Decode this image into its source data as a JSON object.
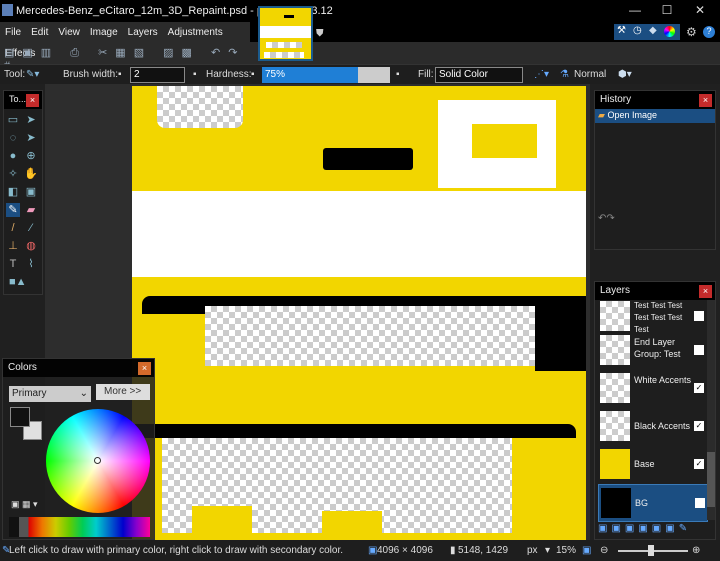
{
  "window": {
    "title": "Mercedes-Benz_eCitaro_12m_3D_Repaint.psd - paint.net 4.3.12",
    "minimize": "—",
    "maximize": "☐",
    "close": "✕"
  },
  "menu": [
    "File",
    "Edit",
    "View",
    "Image",
    "Layers",
    "Adjustments",
    "Effects"
  ],
  "options": {
    "tool_label": "Tool:",
    "brush_width_label": "Brush width:",
    "brush_width": "2",
    "hardness_label": "Hardness:",
    "hardness": "75%",
    "hardness_value": 75,
    "fill_label": "Fill:",
    "fill": "Solid Color",
    "blend": "Normal"
  },
  "tools_panel": {
    "title": "To..."
  },
  "history": {
    "title": "History",
    "items": [
      "Open Image"
    ]
  },
  "layers": {
    "title": "Layers",
    "items": [
      {
        "name": "Test Test Test Test Test Test Test",
        "checked": false
      },
      {
        "name": "End Layer Group: Test",
        "checked": false
      },
      {
        "name": "White Accents",
        "checked": true
      },
      {
        "name": "Black Accents",
        "checked": true
      },
      {
        "name": "Base",
        "checked": true
      },
      {
        "name": "BG",
        "checked": false,
        "selected": true
      }
    ]
  },
  "colors": {
    "title": "Colors",
    "mode": "Primary",
    "more": "More >>",
    "primary": "#111111",
    "secondary": "#e0e0e0"
  },
  "status": {
    "hint": "Left click to draw with primary color, right click to draw with secondary color.",
    "size": "4096 × 4096",
    "cursor": "5148, 1429",
    "unit": "px",
    "zoom": "15%"
  },
  "accent": "#f2d600"
}
